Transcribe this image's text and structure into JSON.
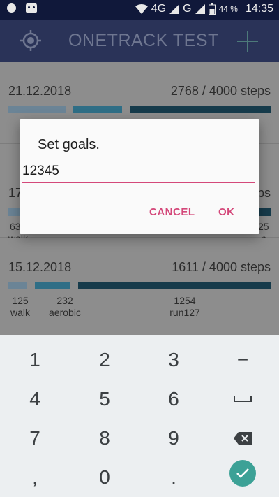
{
  "status_bar": {
    "network_4g": "4G",
    "network_g": "G",
    "battery_percent": "44 %",
    "time": "14:35"
  },
  "app_bar": {
    "title": "ONETRACK TEST"
  },
  "entries": [
    {
      "date": "21.12.2018",
      "steps": "2768 / 4000  steps",
      "segments": [
        {
          "label": "",
          "value": "",
          "color": "#6b8496"
        },
        {
          "label": "",
          "value": "",
          "color": "#2f6e86"
        },
        {
          "label": "",
          "value": "",
          "color": "#163b4b"
        }
      ]
    },
    {
      "date": "17",
      "steps": "ps",
      "segments": [
        {
          "value": "63",
          "label": "walk"
        },
        {
          "value": "25",
          "label": "n"
        }
      ]
    },
    {
      "date": "15.12.2018",
      "steps": "1611 / 4000  steps",
      "segments": [
        {
          "value": "125",
          "label": "walk",
          "color": "#6b8496"
        },
        {
          "value": "232",
          "label": "aerobic",
          "color": "#2f6e86"
        },
        {
          "value": "1254",
          "label": "run127",
          "color": "#163b4b"
        }
      ]
    }
  ],
  "dialog": {
    "title": "Set goals.",
    "input_value": "12345",
    "cancel_label": "CANCEL",
    "ok_label": "OK"
  },
  "keyboard": {
    "rows": [
      [
        "1",
        "2",
        "3",
        "−"
      ],
      [
        "4",
        "5",
        "6",
        "space-icon"
      ],
      [
        "7",
        "8",
        "9",
        "backspace-icon"
      ],
      [
        ",",
        "0",
        ".",
        "enter-icon"
      ]
    ],
    "k1": "1",
    "k2": "2",
    "k3": "3",
    "minus": "−",
    "k4": "4",
    "k5": "5",
    "k6": "6",
    "k7": "7",
    "k8": "8",
    "k9": "9",
    "comma": ",",
    "k0": "0",
    "dot": ".",
    "accent": "#3ca196"
  },
  "colors": {
    "accent_pink": "#d4487a",
    "app_bar": "#2a3358"
  }
}
